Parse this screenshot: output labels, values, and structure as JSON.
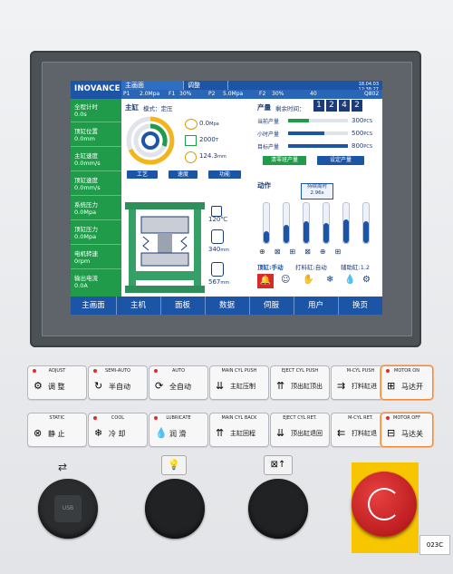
{
  "header": {
    "logo": "INOVANCE",
    "tabs": [
      "主画面",
      "调整"
    ],
    "date": "18.04.03",
    "time": "12:38:27",
    "params": {
      "p1_label": "P1",
      "p1": "2.0Mpa",
      "f1_label": "F1",
      "f1": "30%",
      "p2_label": "P2",
      "p2": "5.0Mpa",
      "f2_label": "F2",
      "f2": "30%",
      "count": "40",
      "code": "Q802"
    }
  },
  "left_panel": [
    {
      "label": "全程计时",
      "value": "0.0s"
    },
    {
      "label": "顶缸位置",
      "value": "0.0mm"
    },
    {
      "label": "主缸速度",
      "value": "0.0mm/s"
    },
    {
      "label": "顶缸速度",
      "value": "0.0mm/s"
    },
    {
      "label": "系统压力",
      "value": "0.0Mpa"
    },
    {
      "label": "顶缸压力",
      "value": "0.0Mpa"
    },
    {
      "label": "电机转速",
      "value": "0rpm"
    },
    {
      "label": "输出电流",
      "value": "0.0A"
    }
  ],
  "main_cyl": {
    "title": "主缸",
    "mode": "模式：定压",
    "gauges": [
      {
        "value": "0.0",
        "unit": "Mpa"
      },
      {
        "value": "2000",
        "unit": "T"
      },
      {
        "value": "124.3",
        "unit": "mm"
      }
    ],
    "buttons": [
      "工艺",
      "速度",
      "功能"
    ],
    "temperature": "120℃",
    "pos_a": "340",
    "pos_a_unit": "mm",
    "pos_b": "567",
    "pos_b_unit": "mm"
  },
  "production": {
    "title": "产量",
    "remaining_label": "剩余时间：",
    "digits": [
      "1",
      "2",
      "4",
      "2"
    ],
    "rows": [
      {
        "label": "当前产量",
        "value": "300",
        "unit": "PCS",
        "fill": 0.35
      },
      {
        "label": "小时产量",
        "value": "500",
        "unit": "PCS",
        "fill": 0.6
      },
      {
        "label": "目标产量",
        "value": "800",
        "unit": "PCS",
        "fill": 1.0
      }
    ],
    "btn_clear": "清零班产量",
    "btn_set": "设定产量"
  },
  "action": {
    "title": "动作",
    "tooltip_line1": "持续周时",
    "tooltip_line2": "2.96s",
    "bar_levels": [
      0.3,
      0.45,
      0.55,
      0.5,
      0.6,
      0.55
    ],
    "status_top": "顶缸:手动",
    "status_cycle": "打料缸:自动",
    "status_aux": "辅助缸:1.2"
  },
  "bottom_nav": [
    "主画面",
    "主机",
    "面板",
    "数据",
    "伺服",
    "用户",
    "换页"
  ],
  "keys_row1": [
    {
      "small": "ADJUST",
      "text": "调  整",
      "led": true,
      "icon": "gear-icon"
    },
    {
      "small": "SEMI-AUTO",
      "text": "半自动",
      "led": true,
      "icon": "semi-auto-icon"
    },
    {
      "small": "AUTO",
      "text": "全自动",
      "led": true,
      "icon": "auto-cycle-icon"
    },
    {
      "small": "MAIN CYL PUSH",
      "text": "主缸压制",
      "led": false,
      "icon": "main-cyl-push-icon"
    },
    {
      "small": "EJECT CYL PUSH",
      "text": "顶出缸顶出",
      "led": false,
      "icon": "eject-cyl-push-icon"
    },
    {
      "small": "M-CYL PUSH",
      "text": "打料缸进",
      "led": false,
      "icon": "m-cyl-push-icon"
    },
    {
      "small": "MOTOR ON",
      "text": "马达开",
      "led": true,
      "icon": "motor-on-icon"
    }
  ],
  "keys_row2": [
    {
      "small": "STATIC",
      "text": "静  止",
      "led": false,
      "icon": "static-icon"
    },
    {
      "small": "COOL",
      "text": "冷  却",
      "led": true,
      "icon": "snowflake-icon"
    },
    {
      "small": "LUBRICATE",
      "text": "润  滑",
      "led": true,
      "icon": "oil-drop-icon"
    },
    {
      "small": "MAIN CYL BACK",
      "text": "主缸回程",
      "led": false,
      "icon": "main-cyl-back-icon"
    },
    {
      "small": "EJECT CYL RET.",
      "text": "顶出缸退回",
      "led": false,
      "icon": "eject-cyl-ret-icon"
    },
    {
      "small": "M-CYL RET.",
      "text": "打料缸退",
      "led": false,
      "icon": "m-cyl-ret-icon"
    },
    {
      "small": "MOTOR OFF",
      "text": "马达关",
      "led": true,
      "icon": "motor-off-icon"
    }
  ],
  "hardware": {
    "usb_label": "USB",
    "model_label": "023C"
  }
}
